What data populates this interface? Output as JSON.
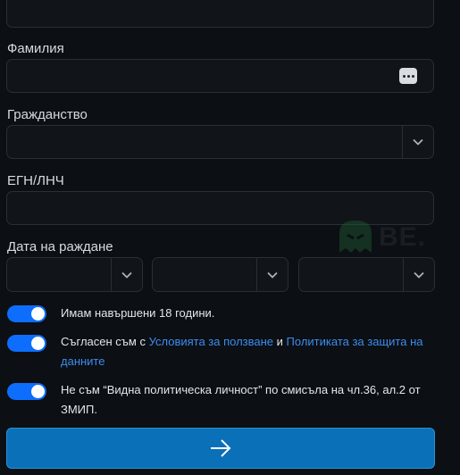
{
  "form": {
    "last_name": {
      "label": "Фамилия",
      "value": ""
    },
    "citizenship": {
      "label": "Гражданство",
      "value": ""
    },
    "egn": {
      "label": "ЕГН/ЛНЧ",
      "value": ""
    },
    "birth_date": {
      "label": "Дата на раждане",
      "day": "",
      "month": "",
      "year": ""
    },
    "consents": [
      {
        "text": "Имам навършени 18 години.",
        "checked": true
      },
      {
        "text_before": "Съгласен съм с ",
        "link1": "Условията за ползване",
        "text_mid": " и ",
        "link2": "Политиката за защита на данните",
        "checked": true
      },
      {
        "text": "Не съм “Видна политическа личност” по смисъла на чл.36, ал.2 от ЗМИП.",
        "checked": true
      }
    ]
  },
  "watermark": {
    "text": "BE."
  },
  "colors": {
    "accent": "#0d6efd",
    "link": "#3d8cf0",
    "submit": "#0a70b8",
    "background": "#0c0f13"
  },
  "icons": {
    "submit": "arrow-right-icon",
    "password_manager": "more-dots-icon",
    "select": "chevron-down-icon"
  }
}
